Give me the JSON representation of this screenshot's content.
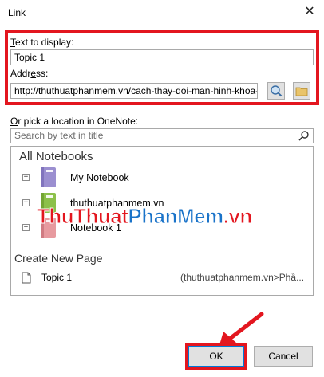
{
  "window": {
    "title": "Link"
  },
  "link_form": {
    "text_label_key": "T",
    "text_label_rest": "ext to display:",
    "text_value": "Topic 1",
    "address_label_pre": "Addr",
    "address_label_key": "e",
    "address_label_post": "ss:",
    "address_value": "http://thuthuatphanmem.vn/cach-thay-doi-man-hinh-khoa-"
  },
  "location": {
    "label_key": "O",
    "label_rest": "r pick a location in OneNote:",
    "search_placeholder": "Search by text in title"
  },
  "tree": {
    "section_title": "All Notebooks",
    "notebooks": [
      {
        "label": "My Notebook",
        "color": "#9b8fd0"
      },
      {
        "label": "thuthuatphanmem.vn",
        "color": "#8cc04a"
      },
      {
        "label": "Notebook 1",
        "color": "#e79a9f"
      }
    ],
    "create_title": "Create New Page",
    "page_item": {
      "label": "Topic 1",
      "location": "(thuthuatphanmem.vn>Phầ..."
    }
  },
  "watermark": {
    "part1": "ThuThuat",
    "part2": "PhanMem",
    "part3": ".vn",
    "color1": "#e3161f",
    "color2": "#1a73c9"
  },
  "buttons": {
    "ok_label": "OK",
    "cancel_label": "Cancel"
  },
  "accent": {
    "highlight": "#e3161f"
  }
}
